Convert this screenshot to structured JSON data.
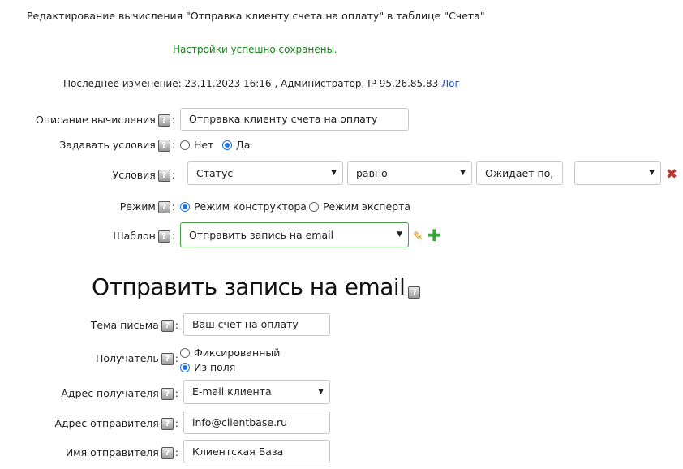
{
  "header": {
    "title": "Редактирование вычисления \"Отправка клиенту счета на оплату\" в таблице \"Счета\"",
    "success_message": "Настройки успешно сохранены.",
    "last_change_text": "Последнее изменение: 23.11.2023 16:16 , Администратор, IP 95.26.85.83",
    "log_link": "Лог"
  },
  "form": {
    "help_symbol": "?",
    "colon": ":",
    "description": {
      "label": "Описание вычисления",
      "value": "Отправка клиенту счета на оплату"
    },
    "set_conditions": {
      "label": "Задавать условия",
      "options": [
        {
          "label": "Нет",
          "checked": false
        },
        {
          "label": "Да",
          "checked": true
        }
      ]
    },
    "conditions": {
      "label": "Условия",
      "field": "Статус",
      "operator": "равно",
      "value": "Ожидает по,",
      "extra": ""
    },
    "mode": {
      "label": "Режим",
      "options": [
        {
          "label": "Режим конструктора",
          "checked": true
        },
        {
          "label": "Режим эксперта",
          "checked": false
        }
      ]
    },
    "template": {
      "label": "Шаблон",
      "value": "Отправить запись на email"
    }
  },
  "email_section": {
    "title": "Отправить запись на email",
    "subject": {
      "label": "Тема письма",
      "value": "Ваш счет на оплату"
    },
    "recipient": {
      "label": "Получатель",
      "options": [
        {
          "label": "Фиксированный",
          "checked": false
        },
        {
          "label": "Из поля",
          "checked": true
        }
      ]
    },
    "recipient_address": {
      "label": "Адрес получателя",
      "value": "E-mail клиента"
    },
    "sender_address": {
      "label": "Адрес отправителя",
      "value": "info@clientbase.ru"
    },
    "sender_name": {
      "label": "Имя отправителя",
      "value": "Клиентская База"
    }
  },
  "icons": {
    "dropdown_arrow": "▼",
    "delete": "✖",
    "edit": "✎",
    "add": "✚"
  },
  "colors": {
    "success": "#1a7f1a",
    "link": "#1a4fd0",
    "radio_checked": "#1a73e8",
    "delete": "#c0392b",
    "add": "#3aa33a",
    "template_border": "#4aa04a"
  }
}
